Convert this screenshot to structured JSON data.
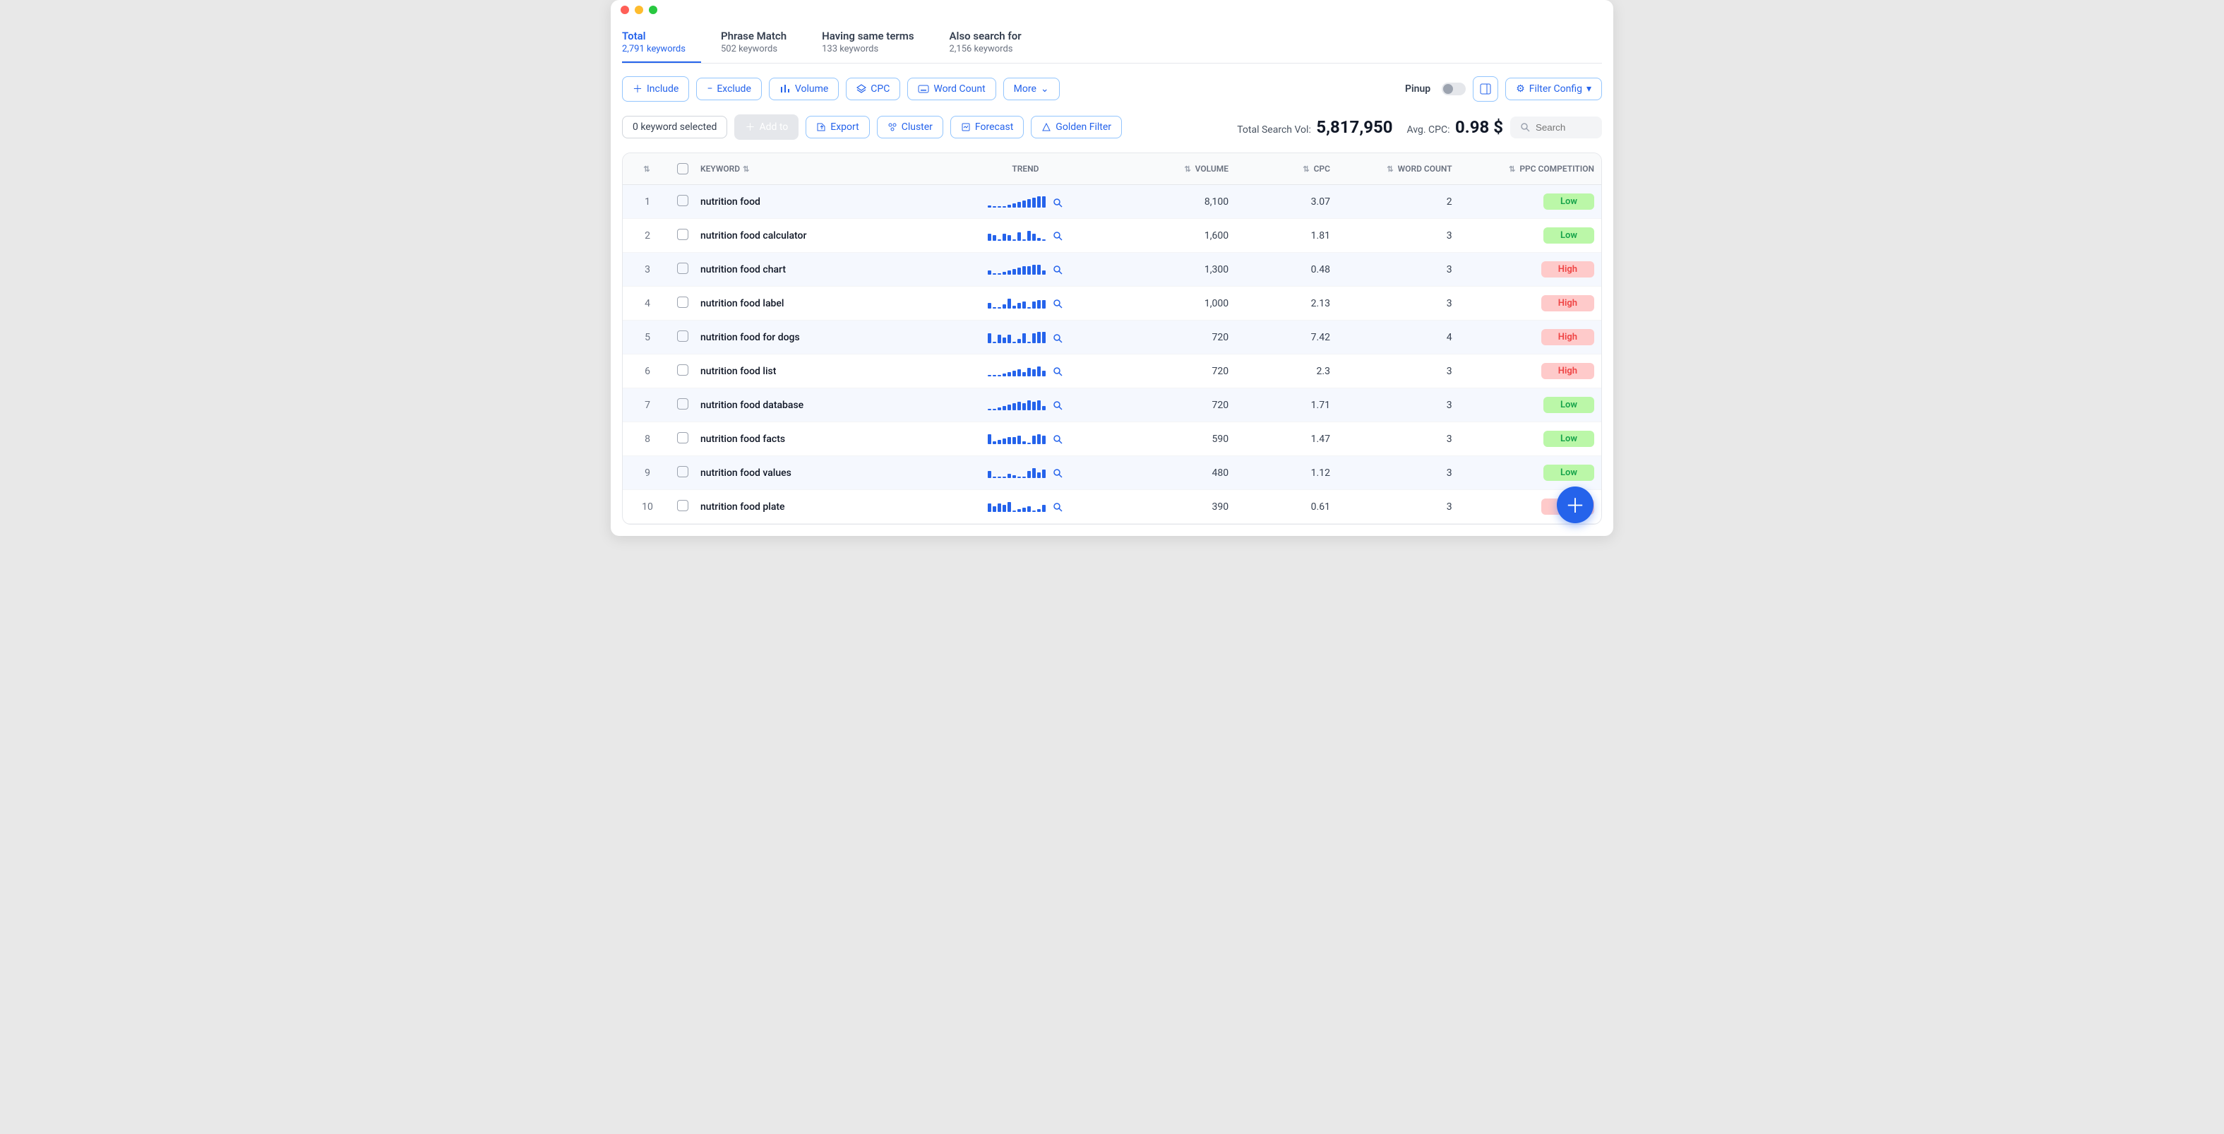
{
  "tabs": [
    {
      "title": "Total",
      "sub": "2,791 keywords",
      "active": true
    },
    {
      "title": "Phrase Match",
      "sub": "502 keywords",
      "active": false
    },
    {
      "title": "Having same terms",
      "sub": "133 keywords",
      "active": false
    },
    {
      "title": "Also search for",
      "sub": "2,156 keywords",
      "active": false
    }
  ],
  "toolbar": {
    "include": "Include",
    "exclude": "Exclude",
    "volume": "Volume",
    "cpc": "CPC",
    "word_count": "Word Count",
    "more": "More",
    "pinup": "Pinup",
    "filter_config": "Filter Config"
  },
  "toolbar2": {
    "selected": "0 keyword selected",
    "add_to": "Add to",
    "export": "Export",
    "cluster": "Cluster",
    "forecast": "Forecast",
    "golden_filter": "Golden Filter",
    "total_search_label": "Total Search Vol:",
    "total_search_val": "5,817,950",
    "avg_cpc_label": "Avg. CPC:",
    "avg_cpc_val": "0.98 $",
    "search_placeholder": "Search"
  },
  "columns": {
    "keyword": "KEYWORD",
    "trend": "TREND",
    "volume": "VOLUME",
    "cpc": "CPC",
    "word_count": "WORD COUNT",
    "ppc": "PPC COMPETITION"
  },
  "rows": [
    {
      "idx": "1",
      "keyword": "nutrition food",
      "volume": "8,100",
      "cpc": "3.07",
      "wc": "2",
      "ppc": "Low",
      "trend": [
        3,
        2,
        2,
        2,
        4,
        6,
        8,
        10,
        12,
        14,
        16,
        16
      ]
    },
    {
      "idx": "2",
      "keyword": "nutrition food calculator",
      "volume": "1,600",
      "cpc": "1.81",
      "wc": "3",
      "ppc": "Low",
      "trend": [
        10,
        8,
        2,
        10,
        8,
        2,
        12,
        2,
        14,
        10,
        4,
        2
      ]
    },
    {
      "idx": "3",
      "keyword": "nutrition food chart",
      "volume": "1,300",
      "cpc": "0.48",
      "wc": "3",
      "ppc": "High",
      "trend": [
        6,
        2,
        2,
        4,
        6,
        8,
        10,
        12,
        12,
        14,
        14,
        6
      ]
    },
    {
      "idx": "4",
      "keyword": "nutrition food label",
      "volume": "1,000",
      "cpc": "2.13",
      "wc": "3",
      "ppc": "High",
      "trend": [
        8,
        2,
        2,
        6,
        14,
        4,
        8,
        10,
        2,
        10,
        12,
        12
      ]
    },
    {
      "idx": "5",
      "keyword": "nutrition food for dogs",
      "volume": "720",
      "cpc": "7.42",
      "wc": "4",
      "ppc": "High",
      "trend": [
        14,
        2,
        12,
        8,
        12,
        2,
        6,
        14,
        2,
        14,
        16,
        16
      ]
    },
    {
      "idx": "6",
      "keyword": "nutrition food list",
      "volume": "720",
      "cpc": "2.3",
      "wc": "3",
      "ppc": "High",
      "trend": [
        2,
        2,
        2,
        4,
        6,
        8,
        10,
        6,
        12,
        10,
        14,
        8
      ]
    },
    {
      "idx": "7",
      "keyword": "nutrition food database",
      "volume": "720",
      "cpc": "1.71",
      "wc": "3",
      "ppc": "Low",
      "trend": [
        2,
        2,
        4,
        6,
        8,
        10,
        12,
        10,
        14,
        12,
        14,
        6
      ]
    },
    {
      "idx": "8",
      "keyword": "nutrition food facts",
      "volume": "590",
      "cpc": "1.47",
      "wc": "3",
      "ppc": "Low",
      "trend": [
        14,
        4,
        6,
        8,
        10,
        10,
        12,
        4,
        2,
        12,
        14,
        12
      ]
    },
    {
      "idx": "9",
      "keyword": "nutrition food values",
      "volume": "480",
      "cpc": "1.12",
      "wc": "3",
      "ppc": "Low",
      "trend": [
        10,
        2,
        2,
        2,
        6,
        4,
        2,
        2,
        10,
        14,
        8,
        12
      ]
    },
    {
      "idx": "10",
      "keyword": "nutrition food plate",
      "volume": "390",
      "cpc": "0.61",
      "wc": "3",
      "ppc": "High",
      "trend": [
        12,
        8,
        12,
        10,
        14,
        2,
        4,
        6,
        8,
        2,
        4,
        10
      ]
    }
  ]
}
